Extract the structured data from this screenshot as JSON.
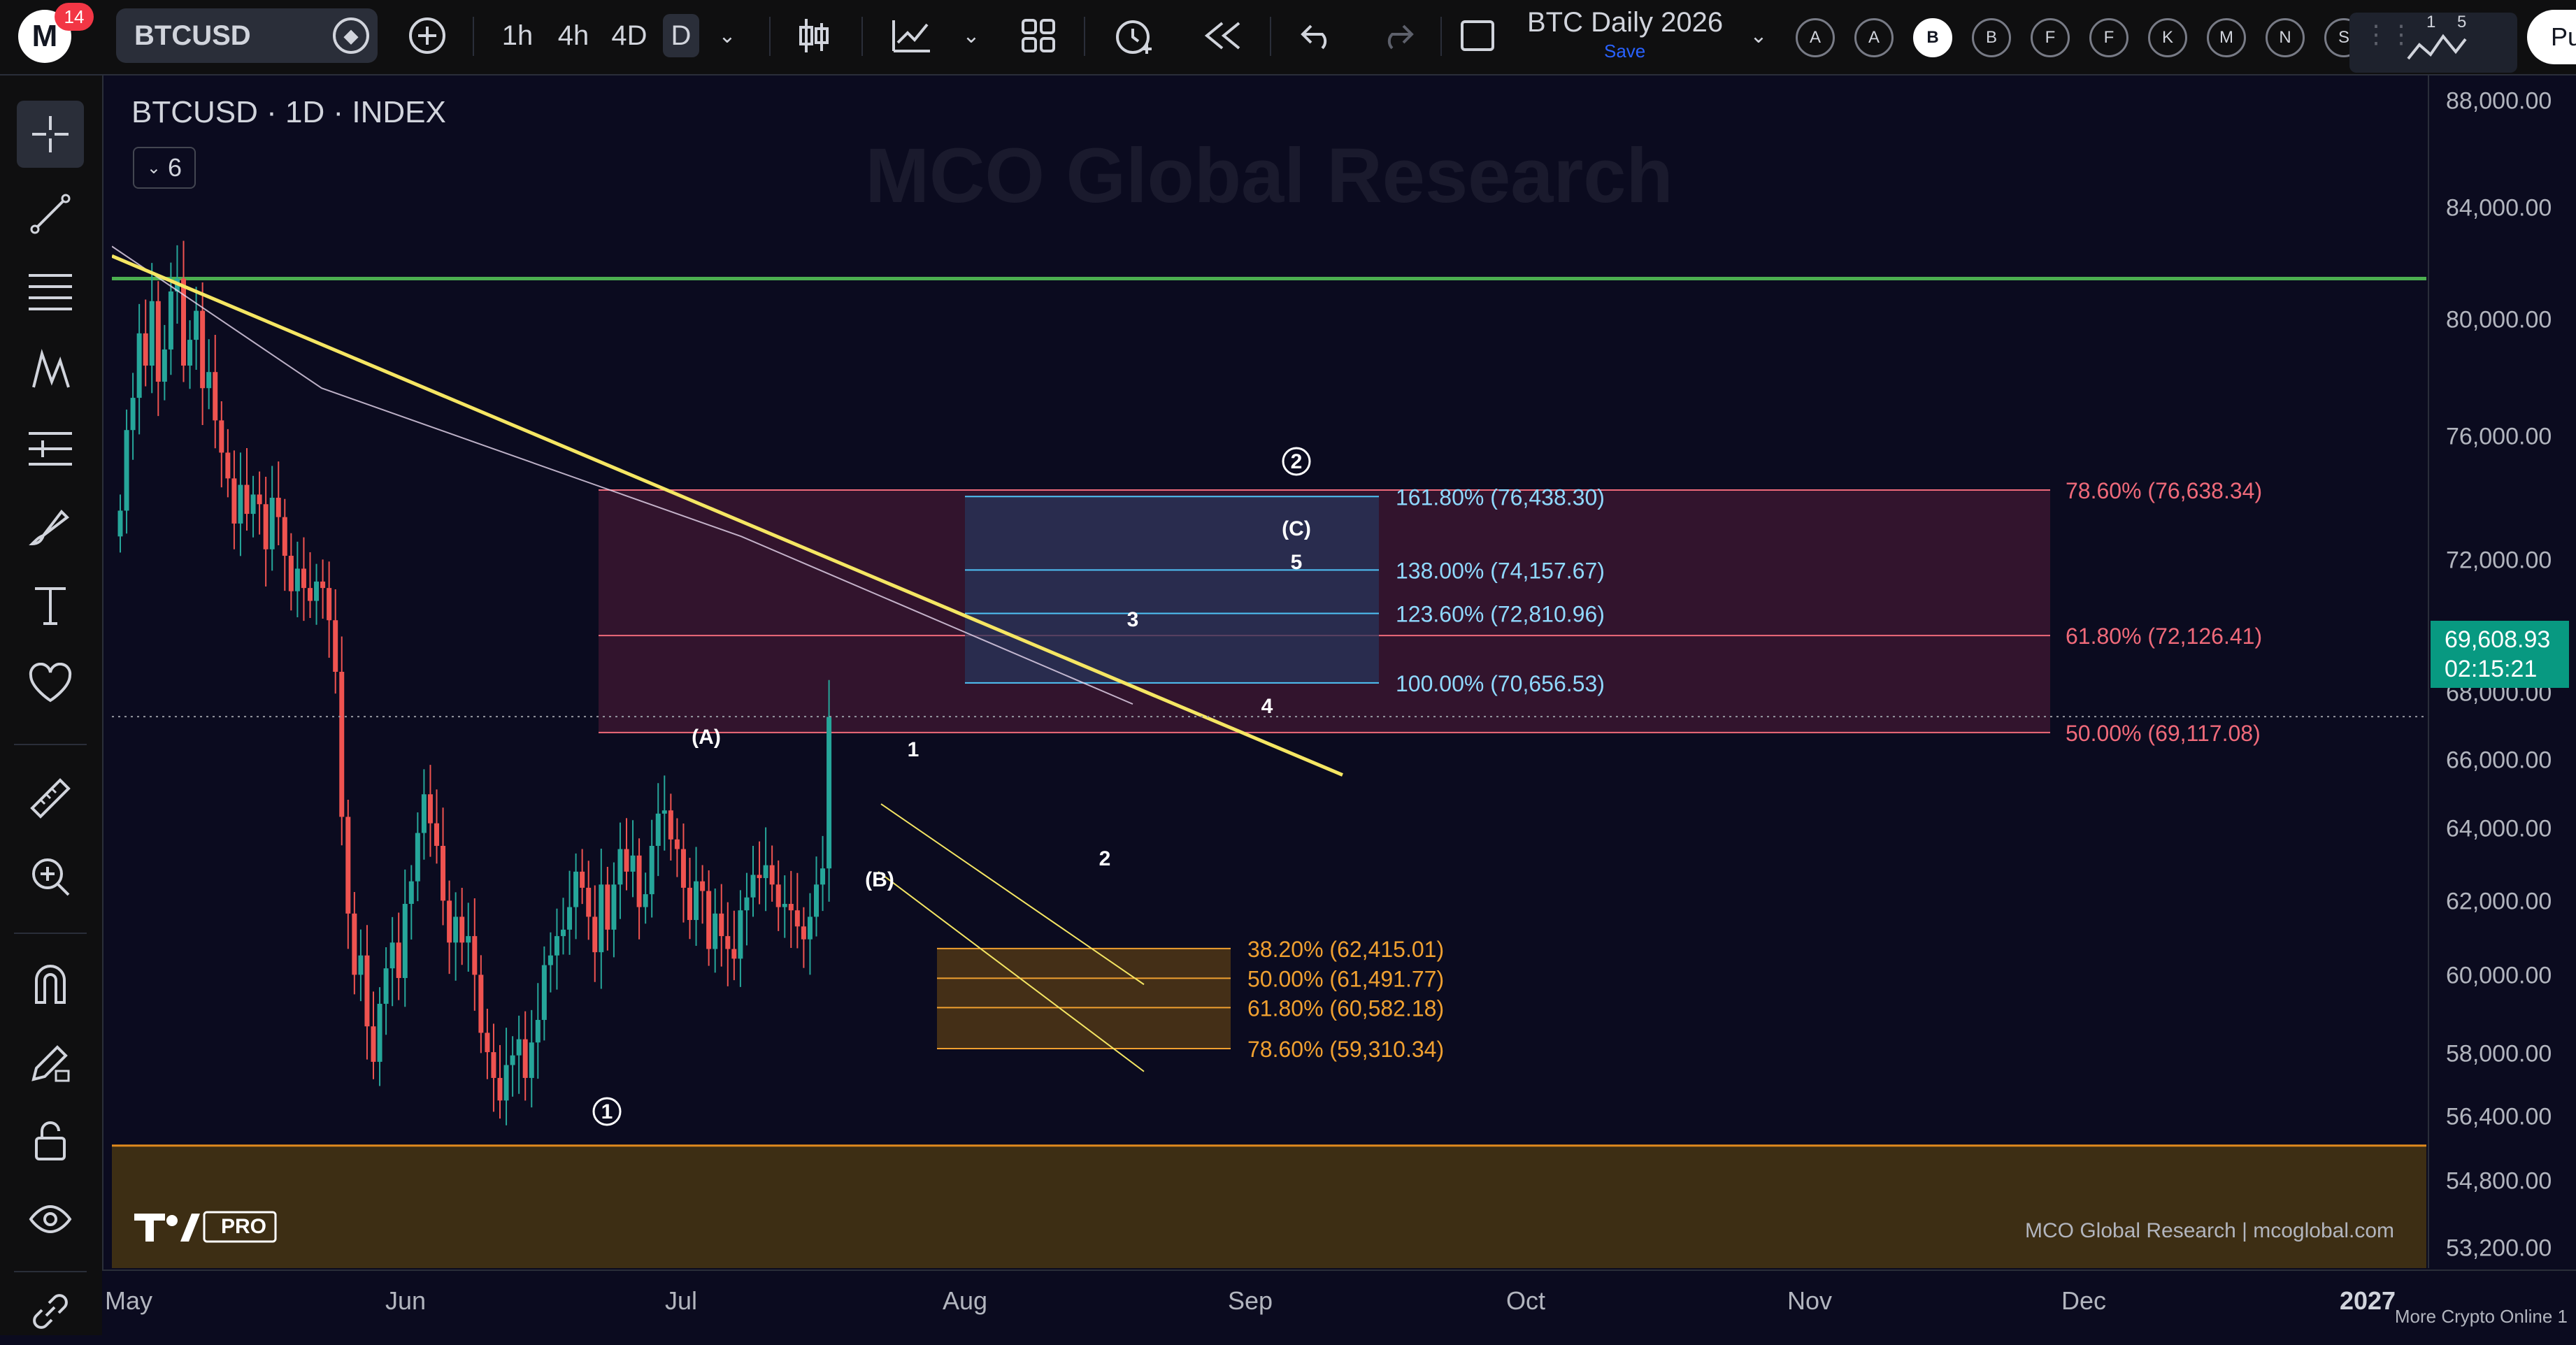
{
  "header": {
    "notification_count": "14",
    "logo_letter": "M",
    "symbol": "BTCUSD",
    "timeframes": [
      "1h",
      "4h",
      "4D",
      "D"
    ],
    "active_timeframe": "D",
    "layout_name": "BTC Daily 2026",
    "save_label": "Save",
    "scripts": [
      "A",
      "A",
      "B",
      "B",
      "F",
      "F",
      "K",
      "M",
      "N",
      "S"
    ],
    "selected_script_index": 2,
    "alerts_counts": [
      "1",
      "5"
    ],
    "publish_label": "Pu"
  },
  "legend": {
    "title": "BTCUSD · 1D · INDEX",
    "indicator_toggle": "6"
  },
  "watermark": "MCO Global Research",
  "footer_note": "MCO Global Research | mcoglobal.com",
  "tv_logo_text": "PRO",
  "price_axis": {
    "labels": [
      "88,000.00",
      "84,000.00",
      "80,000.00",
      "76,000.00",
      "72,000.00",
      "68,000.00",
      "66,000.00",
      "64,000.00",
      "62,000.00",
      "60,000.00",
      "58,000.00",
      "56,400.00",
      "54,800.00",
      "53,200.00"
    ],
    "current_price": "69,608.93",
    "countdown": "02:15:21"
  },
  "time_axis": {
    "labels": [
      "May",
      "Jun",
      "Jul",
      "Aug",
      "Sep",
      "Oct",
      "Nov",
      "Dec",
      "2027"
    ],
    "more_label": "More Crypto Online 1"
  },
  "chart_data": {
    "type": "candlestick",
    "symbol": "BTCUSD",
    "interval": "1D",
    "ylim": [
      52500,
      89500
    ],
    "colors": {
      "up": "#26a69a",
      "down": "#ef5350",
      "trendline": "#f5e663",
      "resistance": "#4caf50",
      "support_zone": "#b36b00"
    },
    "candles_close": [
      76000,
      78500,
      79500,
      81500,
      80500,
      82500,
      80000,
      81000,
      82800,
      83200,
      80500,
      81300,
      82200,
      79800,
      80300,
      78800,
      77800,
      77000,
      75600,
      76800,
      75900,
      76500,
      76200,
      74800,
      76400,
      75800,
      74600,
      73500,
      74200,
      73600,
      73200,
      73800,
      73600,
      72600,
      71000,
      66500,
      63500,
      61600,
      62200,
      60000,
      58900,
      60700,
      61800,
      62600,
      61500,
      63800,
      64500,
      66000,
      67200,
      66300,
      65600,
      63900,
      62600,
      63400,
      62600,
      62800,
      61600,
      59800,
      59200,
      58400,
      57700,
      58800,
      59100,
      59600,
      58400,
      59500,
      60200,
      61900,
      62200,
      62800,
      63000,
      63700,
      64800,
      64300,
      63400,
      62300,
      64400,
      63000,
      64400,
      65500,
      64800,
      65300,
      63700,
      64100,
      65600,
      66600,
      66700,
      65800,
      65500,
      64300,
      63300,
      64500,
      64200,
      62400,
      63500,
      62800,
      62400,
      62100,
      63600,
      64000,
      64700,
      64600,
      65000,
      64400,
      63700,
      63800,
      63600,
      63100,
      62700,
      63400,
      64400,
      64900,
      69600
    ],
    "resistance_level": 83200,
    "support_zone": [
      53200,
      56300
    ],
    "trendline": [
      {
        "x": "May",
        "y": 83400
      },
      {
        "x": "Sep",
        "y": 68200
      }
    ],
    "fibs_retracement": [
      {
        "label": "78.60% (76,638.34)",
        "price": 76638.34
      },
      {
        "label": "61.80% (72,126.41)",
        "price": 72126.41
      },
      {
        "label": "50.00% (69,117.08)",
        "price": 69117.08
      }
    ],
    "fibs_extension": [
      {
        "label": "161.80% (76,438.30)",
        "price": 76438.3
      },
      {
        "label": "138.00% (74,157.67)",
        "price": 74157.67
      },
      {
        "label": "123.60% (72,810.96)",
        "price": 72810.96
      },
      {
        "label": "100.00% (70,656.53)",
        "price": 70656.53
      }
    ],
    "fibs_support": [
      {
        "label": "38.20% (62,415.01)",
        "price": 62415.01
      },
      {
        "label": "50.00% (61,491.77)",
        "price": 61491.77
      },
      {
        "label": "61.80% (60,582.18)",
        "price": 60582.18
      },
      {
        "label": "78.60% (59,310.34)",
        "price": 59310.34
      }
    ],
    "wave_labels": [
      "①",
      "(A)",
      "(B)",
      "1",
      "2",
      "3",
      "4",
      "5",
      "(C)",
      "②"
    ]
  }
}
